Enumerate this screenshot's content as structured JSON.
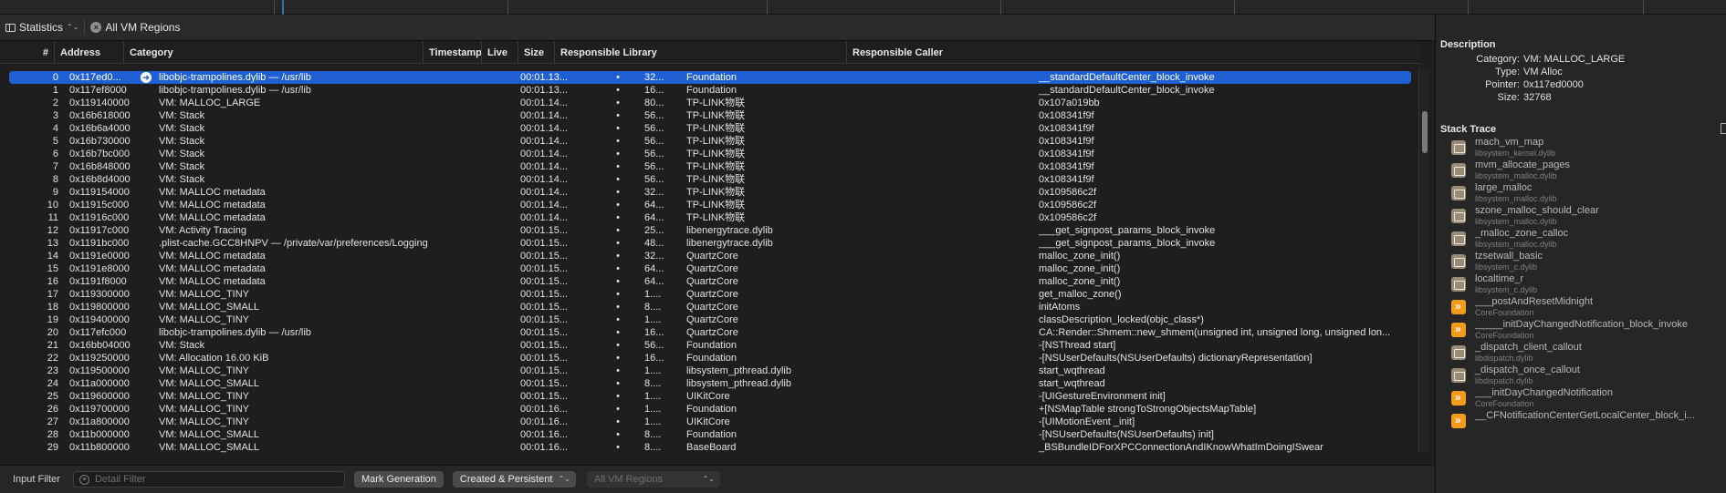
{
  "toolbar": {
    "view_label": "Statistics",
    "filter_label": "All VM Regions"
  },
  "columns": {
    "num": "#",
    "address": "Address",
    "category": "Category",
    "timestamp": "Timestamp",
    "live": "Live",
    "size": "Size",
    "library": "Responsible Library",
    "caller": "Responsible Caller"
  },
  "rows": [
    {
      "num": "0",
      "address": "0x117ed0...",
      "category": "libobjc-trampolines.dylib — /usr/lib",
      "timestamp": "00:01.13...",
      "live": "•",
      "size": "32...",
      "library": "Foundation",
      "caller": "__standardDefaultCenter_block_invoke"
    },
    {
      "num": "1",
      "address": "0x117ef8000",
      "category": "libobjc-trampolines.dylib — /usr/lib",
      "timestamp": "00:01.13...",
      "live": "•",
      "size": "16...",
      "library": "Foundation",
      "caller": "__standardDefaultCenter_block_invoke"
    },
    {
      "num": "2",
      "address": "0x119140000",
      "category": "VM: MALLOC_LARGE",
      "timestamp": "00:01.14...",
      "live": "•",
      "size": "80...",
      "library": "TP-LINK物联",
      "caller": "0x107a019bb"
    },
    {
      "num": "3",
      "address": "0x16b618000",
      "category": "VM: Stack",
      "timestamp": "00:01.14...",
      "live": "•",
      "size": "56...",
      "library": "TP-LINK物联",
      "caller": "0x108341f9f"
    },
    {
      "num": "4",
      "address": "0x16b6a4000",
      "category": "VM: Stack",
      "timestamp": "00:01.14...",
      "live": "•",
      "size": "56...",
      "library": "TP-LINK物联",
      "caller": "0x108341f9f"
    },
    {
      "num": "5",
      "address": "0x16b730000",
      "category": "VM: Stack",
      "timestamp": "00:01.14...",
      "live": "•",
      "size": "56...",
      "library": "TP-LINK物联",
      "caller": "0x108341f9f"
    },
    {
      "num": "6",
      "address": "0x16b7bc000",
      "category": "VM: Stack",
      "timestamp": "00:01.14...",
      "live": "•",
      "size": "56...",
      "library": "TP-LINK物联",
      "caller": "0x108341f9f"
    },
    {
      "num": "7",
      "address": "0x16b848000",
      "category": "VM: Stack",
      "timestamp": "00:01.14...",
      "live": "•",
      "size": "56...",
      "library": "TP-LINK物联",
      "caller": "0x108341f9f"
    },
    {
      "num": "8",
      "address": "0x16b8d4000",
      "category": "VM: Stack",
      "timestamp": "00:01.14...",
      "live": "•",
      "size": "56...",
      "library": "TP-LINK物联",
      "caller": "0x108341f9f"
    },
    {
      "num": "9",
      "address": "0x119154000",
      "category": "VM: MALLOC metadata",
      "timestamp": "00:01.14...",
      "live": "•",
      "size": "32...",
      "library": "TP-LINK物联",
      "caller": "0x109586c2f"
    },
    {
      "num": "10",
      "address": "0x11915c000",
      "category": "VM: MALLOC metadata",
      "timestamp": "00:01.14...",
      "live": "•",
      "size": "64...",
      "library": "TP-LINK物联",
      "caller": "0x109586c2f"
    },
    {
      "num": "11",
      "address": "0x11916c000",
      "category": "VM: MALLOC metadata",
      "timestamp": "00:01.14...",
      "live": "•",
      "size": "64...",
      "library": "TP-LINK物联",
      "caller": "0x109586c2f"
    },
    {
      "num": "12",
      "address": "0x11917c000",
      "category": "VM: Activity Tracing",
      "timestamp": "00:01.15...",
      "live": "•",
      "size": "25...",
      "library": "libenergytrace.dylib",
      "caller": "___get_signpost_params_block_invoke"
    },
    {
      "num": "13",
      "address": "0x1191bc000",
      "category": ".plist-cache.GCC8HNPV — /private/var/preferences/Logging",
      "timestamp": "00:01.15...",
      "live": "•",
      "size": "48...",
      "library": "libenergytrace.dylib",
      "caller": "___get_signpost_params_block_invoke"
    },
    {
      "num": "14",
      "address": "0x1191e0000",
      "category": "VM: MALLOC metadata",
      "timestamp": "00:01.15...",
      "live": "•",
      "size": "32...",
      "library": "QuartzCore",
      "caller": "malloc_zone_init()"
    },
    {
      "num": "15",
      "address": "0x1191e8000",
      "category": "VM: MALLOC metadata",
      "timestamp": "00:01.15...",
      "live": "•",
      "size": "64...",
      "library": "QuartzCore",
      "caller": "malloc_zone_init()"
    },
    {
      "num": "16",
      "address": "0x1191f8000",
      "category": "VM: MALLOC metadata",
      "timestamp": "00:01.15...",
      "live": "•",
      "size": "64...",
      "library": "QuartzCore",
      "caller": "malloc_zone_init()"
    },
    {
      "num": "17",
      "address": "0x119300000",
      "category": "VM: MALLOC_TINY",
      "timestamp": "00:01.15...",
      "live": "•",
      "size": "1....",
      "library": "QuartzCore",
      "caller": "get_malloc_zone()"
    },
    {
      "num": "18",
      "address": "0x119800000",
      "category": "VM: MALLOC_SMALL",
      "timestamp": "00:01.15...",
      "live": "•",
      "size": "8....",
      "library": "QuartzCore",
      "caller": "initAtoms"
    },
    {
      "num": "19",
      "address": "0x119400000",
      "category": "VM: MALLOC_TINY",
      "timestamp": "00:01.15...",
      "live": "•",
      "size": "1....",
      "library": "QuartzCore",
      "caller": "classDescription_locked(objc_class*)"
    },
    {
      "num": "20",
      "address": "0x117efc000",
      "category": "libobjc-trampolines.dylib — /usr/lib",
      "timestamp": "00:01.15...",
      "live": "•",
      "size": "16...",
      "library": "QuartzCore",
      "caller": "CA::Render::Shmem::new_shmem(unsigned int, unsigned long, unsigned lon..."
    },
    {
      "num": "21",
      "address": "0x16bb04000",
      "category": "VM: Stack",
      "timestamp": "00:01.15...",
      "live": "•",
      "size": "56...",
      "library": "Foundation",
      "caller": "-[NSThread start]"
    },
    {
      "num": "22",
      "address": "0x119250000",
      "category": "VM: Allocation 16.00 KiB",
      "timestamp": "00:01.15...",
      "live": "•",
      "size": "16...",
      "library": "Foundation",
      "caller": "-[NSUserDefaults(NSUserDefaults) dictionaryRepresentation]"
    },
    {
      "num": "23",
      "address": "0x119500000",
      "category": "VM: MALLOC_TINY",
      "timestamp": "00:01.15...",
      "live": "•",
      "size": "1....",
      "library": "libsystem_pthread.dylib",
      "caller": "start_wqthread"
    },
    {
      "num": "24",
      "address": "0x11a000000",
      "category": "VM: MALLOC_SMALL",
      "timestamp": "00:01.15...",
      "live": "•",
      "size": "8....",
      "library": "libsystem_pthread.dylib",
      "caller": "start_wqthread"
    },
    {
      "num": "25",
      "address": "0x119600000",
      "category": "VM: MALLOC_TINY",
      "timestamp": "00:01.15...",
      "live": "•",
      "size": "1....",
      "library": "UIKitCore",
      "caller": "-[UIGestureEnvironment init]"
    },
    {
      "num": "26",
      "address": "0x119700000",
      "category": "VM: MALLOC_TINY",
      "timestamp": "00:01.16...",
      "live": "•",
      "size": "1....",
      "library": "Foundation",
      "caller": "+[NSMapTable strongToStrongObjectsMapTable]"
    },
    {
      "num": "27",
      "address": "0x11a800000",
      "category": "VM: MALLOC_TINY",
      "timestamp": "00:01.16...",
      "live": "•",
      "size": "1....",
      "library": "UIKitCore",
      "caller": "-[UIMotionEvent _init]"
    },
    {
      "num": "28",
      "address": "0x11b000000",
      "category": "VM: MALLOC_SMALL",
      "timestamp": "00:01.16...",
      "live": "•",
      "size": "8....",
      "library": "Foundation",
      "caller": "-[NSUserDefaults(NSUserDefaults) init]"
    },
    {
      "num": "29",
      "address": "0x11b800000",
      "category": "VM: MALLOC_SMALL",
      "timestamp": "00:01.16...",
      "live": "•",
      "size": "8....",
      "library": "BaseBoard",
      "caller": "_BSBundleIDForXPCConnectionAndIKnowWhatImDoingISwear"
    }
  ],
  "bottom": {
    "filter_label": "Input Filter",
    "filter_placeholder": "Detail Filter",
    "mark_button": "Mark Generation",
    "mode_select": "Created & Persistent",
    "regions_select": "All VM Regions"
  },
  "inspector": {
    "description_title": "Description",
    "description": [
      {
        "key": "Category:",
        "value": "VM: MALLOC_LARGE"
      },
      {
        "key": "Type:",
        "value": "VM Alloc"
      },
      {
        "key": "Pointer:",
        "value": "0x117ed0000"
      },
      {
        "key": "Size:",
        "value": "32768"
      }
    ],
    "stack_title": "Stack Trace",
    "frames": [
      {
        "fn": "mach_vm_map",
        "lib": "libsystem_kernel.dylib",
        "icon": "library-icon"
      },
      {
        "fn": "mvm_allocate_pages",
        "lib": "libsystem_malloc.dylib",
        "icon": "library-icon"
      },
      {
        "fn": "large_malloc",
        "lib": "libsystem_malloc.dylib",
        "icon": "library-icon"
      },
      {
        "fn": "szone_malloc_should_clear",
        "lib": "libsystem_malloc.dylib",
        "icon": "library-icon"
      },
      {
        "fn": "_malloc_zone_calloc",
        "lib": "libsystem_malloc.dylib",
        "icon": "library-icon"
      },
      {
        "fn": "tzsetwall_basic",
        "lib": "libsystem_c.dylib",
        "icon": "library-icon"
      },
      {
        "fn": "localtime_r",
        "lib": "libsystem_c.dylib",
        "icon": "library-icon"
      },
      {
        "fn": "___postAndResetMidnight",
        "lib": "CoreFoundation",
        "icon": "framework-icon"
      },
      {
        "fn": "_____initDayChangedNotification_block_invoke",
        "lib": "CoreFoundation",
        "icon": "framework-icon"
      },
      {
        "fn": "_dispatch_client_callout",
        "lib": "libdispatch.dylib",
        "icon": "library-icon"
      },
      {
        "fn": "_dispatch_once_callout",
        "lib": "libdispatch.dylib",
        "icon": "library-icon"
      },
      {
        "fn": "___initDayChangedNotification",
        "lib": "CoreFoundation",
        "icon": "framework-icon"
      },
      {
        "fn": "__CFNotificationCenterGetLocalCenter_block_i...",
        "lib": "",
        "icon": "framework-icon"
      }
    ]
  },
  "colors": {
    "selection": "#1f5fd1",
    "background": "#1e1e1e",
    "framework_icon": "#f49b1a",
    "library_icon": "#9a8a78"
  }
}
